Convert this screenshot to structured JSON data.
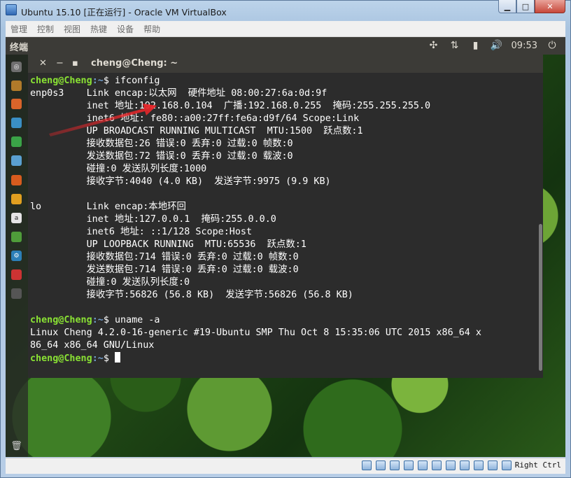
{
  "window": {
    "title": "Ubuntu 15.10 [正在运行] - Oracle VM VirtualBox"
  },
  "menu": [
    "管理",
    "控制",
    "视图",
    "热键",
    "设备",
    "帮助"
  ],
  "topbar": {
    "label": "终端",
    "clock": "09:53"
  },
  "terminal": {
    "title": "cheng@Cheng: ~",
    "prompt_user": "cheng@Cheng",
    "prompt_path": ":~",
    "prompt_symbol": "$ ",
    "lines": [
      {
        "kind": "prompt",
        "cmd": "ifconfig"
      },
      {
        "kind": "text",
        "text": "enp0s3    Link encap:以太网  硬件地址 08:00:27:6a:0d:9f"
      },
      {
        "kind": "text",
        "text": "          inet 地址:192.168.0.104  广播:192.168.0.255  掩码:255.255.255.0"
      },
      {
        "kind": "text",
        "text": "          inet6 地址: fe80::a00:27ff:fe6a:d9f/64 Scope:Link"
      },
      {
        "kind": "text",
        "text": "          UP BROADCAST RUNNING MULTICAST  MTU:1500  跃点数:1"
      },
      {
        "kind": "text",
        "text": "          接收数据包:26 错误:0 丢弃:0 过载:0 帧数:0"
      },
      {
        "kind": "text",
        "text": "          发送数据包:72 错误:0 丢弃:0 过载:0 载波:0"
      },
      {
        "kind": "text",
        "text": "          碰撞:0 发送队列长度:1000"
      },
      {
        "kind": "text",
        "text": "          接收字节:4040 (4.0 KB)  发送字节:9975 (9.9 KB)"
      },
      {
        "kind": "text",
        "text": ""
      },
      {
        "kind": "text",
        "text": "lo        Link encap:本地环回"
      },
      {
        "kind": "text",
        "text": "          inet 地址:127.0.0.1  掩码:255.0.0.0"
      },
      {
        "kind": "text",
        "text": "          inet6 地址: ::1/128 Scope:Host"
      },
      {
        "kind": "text",
        "text": "          UP LOOPBACK RUNNING  MTU:65536  跃点数:1"
      },
      {
        "kind": "text",
        "text": "          接收数据包:714 错误:0 丢弃:0 过载:0 帧数:0"
      },
      {
        "kind": "text",
        "text": "          发送数据包:714 错误:0 丢弃:0 过载:0 载波:0"
      },
      {
        "kind": "text",
        "text": "          碰撞:0 发送队列长度:0"
      },
      {
        "kind": "text",
        "text": "          接收字节:56826 (56.8 KB)  发送字节:56826 (56.8 KB)"
      },
      {
        "kind": "text",
        "text": ""
      },
      {
        "kind": "prompt",
        "cmd": "uname -a"
      },
      {
        "kind": "text",
        "text": "Linux Cheng 4.2.0-16-generic #19-Ubuntu SMP Thu Oct 8 15:35:06 UTC 2015 x86_64 x"
      },
      {
        "kind": "text",
        "text": "86_64 x86_64 GNU/Linux"
      },
      {
        "kind": "prompt_cursor",
        "cmd": ""
      }
    ]
  },
  "statusbar": {
    "host_key": "Right Ctrl"
  },
  "colors": {
    "prompt_user": "#8ae234",
    "prompt_path": "#729fcf",
    "annotation_arrow": "#e8262a"
  }
}
